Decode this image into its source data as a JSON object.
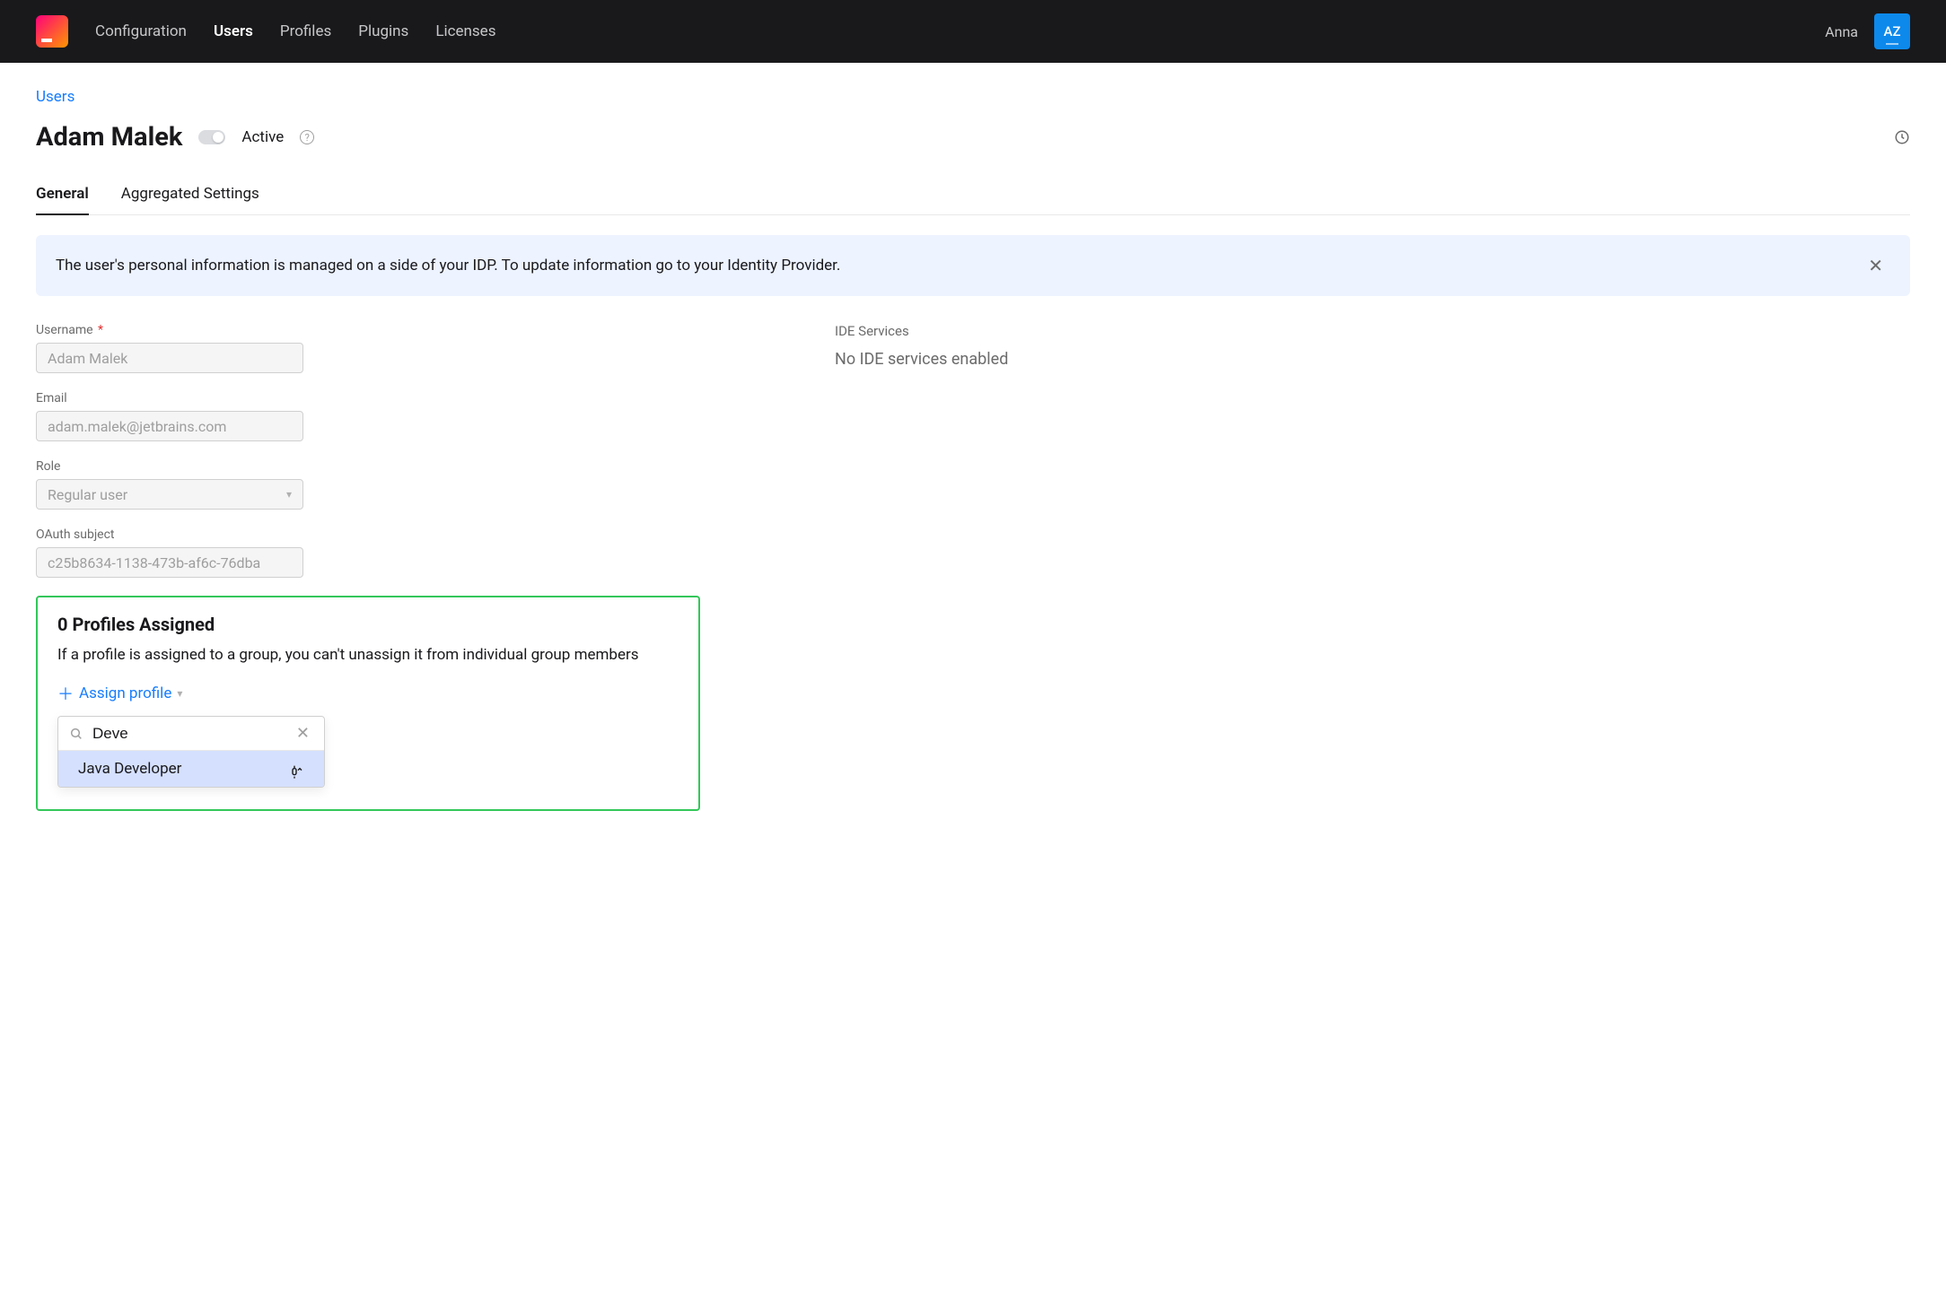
{
  "topbar": {
    "nav": {
      "configuration": "Configuration",
      "users": "Users",
      "profiles": "Profiles",
      "plugins": "Plugins",
      "licenses": "Licenses"
    },
    "user_name": "Anna",
    "avatar_initials": "AZ"
  },
  "breadcrumb": "Users",
  "page_title": "Adam Malek",
  "status_label": "Active",
  "tabs": {
    "general": "General",
    "aggregated": "Aggregated Settings"
  },
  "notice": "The user's personal information is managed on a side of your IDP. To update information go to your Identity Provider.",
  "fields": {
    "username_label": "Username",
    "username_value": "Adam Malek",
    "email_label": "Email",
    "email_value": "adam.malek@jetbrains.com",
    "role_label": "Role",
    "role_value": "Regular user",
    "oauth_label": "OAuth subject",
    "oauth_value": "c25b8634-1138-473b-af6c-76dba"
  },
  "ide": {
    "label": "IDE Services",
    "text": "No IDE services enabled"
  },
  "profiles": {
    "title": "0 Profiles Assigned",
    "desc": "If a profile is assigned to a group, you can't unassign it from individual group members",
    "assign_label": "Assign profile",
    "search_value": "Deve",
    "option": "Java Developer"
  }
}
